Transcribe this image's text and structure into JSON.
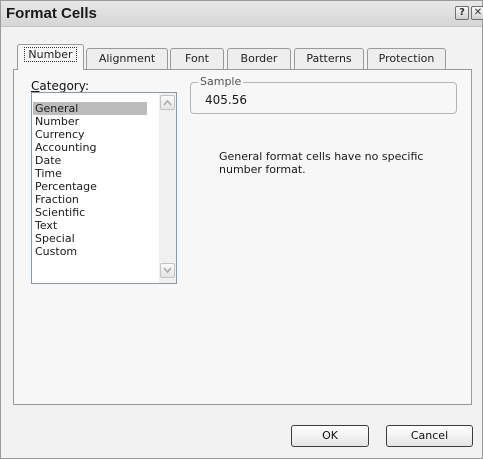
{
  "window": {
    "title": "Format Cells",
    "help_glyph": "?",
    "close_glyph": "✕"
  },
  "tabs": [
    {
      "label": "Number",
      "active": true
    },
    {
      "label": "Alignment"
    },
    {
      "label": "Font"
    },
    {
      "label": "Border"
    },
    {
      "label": "Patterns"
    },
    {
      "label": "Protection"
    }
  ],
  "category": {
    "label_accel": "C",
    "label_rest": "ategory:",
    "items": [
      "General",
      "Number",
      "Currency",
      "Accounting",
      "Date",
      "Time",
      "Percentage",
      "Fraction",
      "Scientific",
      "Text",
      "Special",
      "Custom"
    ],
    "selected": "General"
  },
  "sample": {
    "legend": "Sample",
    "value": "405.56"
  },
  "description": "General format cells have no specific number format.",
  "buttons": {
    "ok": "OK",
    "cancel": "Cancel"
  }
}
